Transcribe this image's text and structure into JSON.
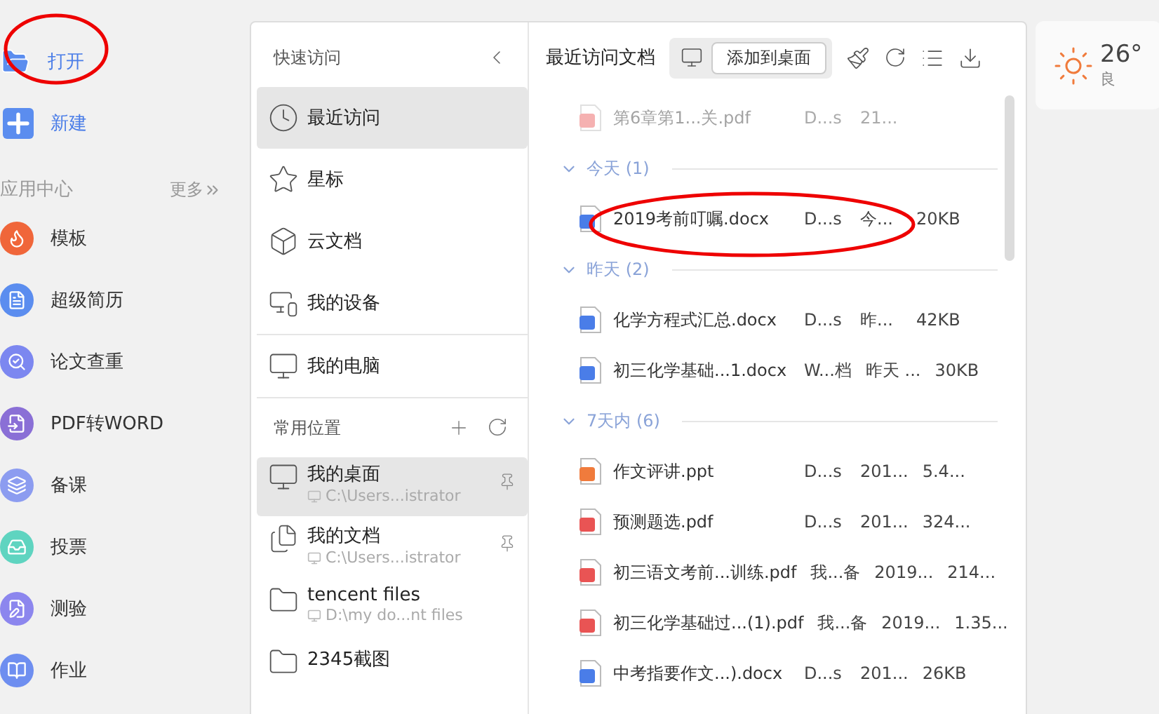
{
  "sidebar": {
    "actions": [
      {
        "label": "打开",
        "kind": "open"
      },
      {
        "label": "新建",
        "kind": "new"
      }
    ],
    "section_title": "应用中心",
    "more": "更多",
    "apps": [
      {
        "label": "模板",
        "color": "#f0663a"
      },
      {
        "label": "超级简历",
        "color": "#5b8def"
      },
      {
        "label": "论文查重",
        "color": "#7c87f0"
      },
      {
        "label": "PDF转WORD",
        "color": "#8a6fd6"
      },
      {
        "label": "备课",
        "color": "#8c9cf0"
      },
      {
        "label": "投票",
        "color": "#5fd4c0"
      },
      {
        "label": "测验",
        "color": "#8c86ee"
      },
      {
        "label": "作业",
        "color": "#6e8ef0"
      }
    ]
  },
  "nav": {
    "title": "快速访问",
    "items": [
      {
        "label": "最近访问",
        "kind": "clock",
        "selected": true
      },
      {
        "label": "星标",
        "kind": "star",
        "selected": false
      },
      {
        "label": "云文档",
        "kind": "cube",
        "selected": false
      },
      {
        "label": "我的设备",
        "kind": "devices",
        "selected": false
      },
      {
        "label": "我的电脑",
        "kind": "computer",
        "selected": false
      }
    ],
    "section_title": "常用位置",
    "locations": [
      {
        "name": "我的桌面",
        "path": "C:\\Users...istrator",
        "kind": "desktop",
        "selected": true,
        "pinned": true
      },
      {
        "name": "我的文档",
        "path": "C:\\Users...istrator",
        "kind": "documents",
        "selected": false,
        "pinned": true
      },
      {
        "name": "tencent files",
        "path": "D:\\my do...nt files",
        "kind": "folder",
        "selected": false,
        "pinned": false
      },
      {
        "name": "2345截图",
        "kind": "folder",
        "selected": false,
        "pinned": false
      }
    ]
  },
  "files": {
    "title": "最近访问文档",
    "add_button": "添加到桌面",
    "leading_files": [
      {
        "name": "第6章第1...关.pdf",
        "location": "D...s",
        "time": "21...",
        "kind": "pdf",
        "faded": true
      }
    ],
    "groups": [
      {
        "label": "今天 (1)",
        "expanded": true,
        "files": [
          {
            "name": "2019考前叮嘱.docx",
            "location": "D...s",
            "time": "今...",
            "size": "20KB",
            "kind": "docx",
            "faded": false
          }
        ]
      },
      {
        "label": "昨天 (2)",
        "expanded": true,
        "files": [
          {
            "name": "化学方程式汇总.docx",
            "location": "D...s",
            "time": "昨...",
            "size": "42KB",
            "kind": "docx",
            "faded": false
          },
          {
            "name": "初三化学基础...1.docx",
            "location": "W...档",
            "time": "昨天 ...",
            "size": "30KB",
            "kind": "docx",
            "faded": false
          }
        ]
      },
      {
        "label": "7天内 (6)",
        "expanded": true,
        "files": [
          {
            "name": "作文评讲.ppt",
            "location": "D...s",
            "time": "201...",
            "size": "5.4...",
            "kind": "ppt",
            "faded": false
          },
          {
            "name": "预测题选.pdf",
            "location": "D...s",
            "time": "201...",
            "size": "324...",
            "kind": "pdf",
            "faded": false
          },
          {
            "name": "初三语文考前...训练.pdf",
            "location": "我...备",
            "time": "2019...",
            "size": "214...",
            "kind": "pdf",
            "faded": false
          },
          {
            "name": "初三化学基础过...(1).pdf",
            "location": "我...备",
            "time": "2019...",
            "size": "1.35...",
            "kind": "pdf",
            "faded": false
          },
          {
            "name": "中考指要作文...).docx",
            "location": "D...s",
            "time": "201...",
            "size": "26KB",
            "kind": "docx",
            "faded": false
          }
        ]
      }
    ]
  },
  "weather": {
    "temperature": "26°",
    "quality": "良"
  }
}
